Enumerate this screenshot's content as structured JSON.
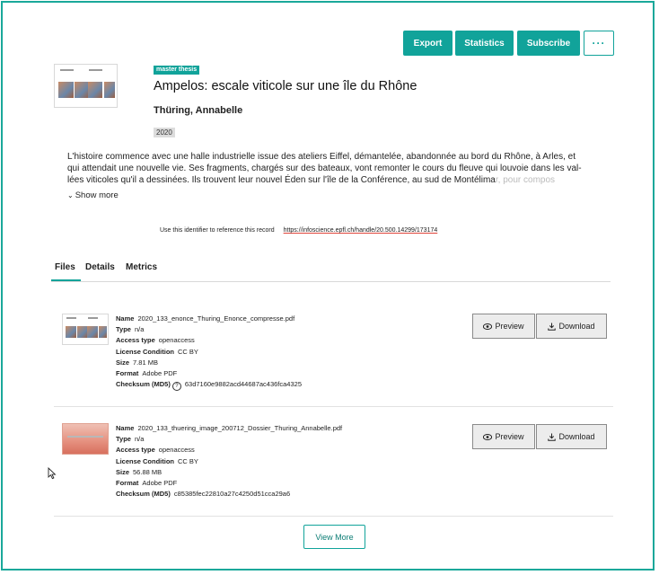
{
  "actions": {
    "export": "Export",
    "statistics": "Statistics",
    "subscribe": "Subscribe",
    "more": "···"
  },
  "record": {
    "type_badge": "master thesis",
    "title": "Ampelos: escale viticole sur une île du Rhône",
    "author": "Thüring, Annabelle",
    "year": "2020",
    "abstract_lines": [
      "L'histoire commence avec une halle industrielle issue des ateliers Eiffel, démantelée, abandonnée au bord du Rhône, à Arles, et",
      "qui attendait une nouvelle vie. Ses fragments, chargés sur des bateaux, vont remonter le cours du fleuve qui louvoie dans les val-",
      "lées viticoles qu'il a dessinées. Ils trouvent leur nouvel Éden sur l'île de la Conférence, au sud de Montélimar, pour compos"
    ],
    "show_more": "Show more",
    "identifier_label": "Use this identifier to reference this record",
    "identifier_url": "https://infoscience.epfl.ch/handle/20.500.14299/173174"
  },
  "tabs": [
    "Files",
    "Details",
    "Metrics"
  ],
  "field_labels": {
    "name": "Name",
    "type": "Type",
    "access": "Access type",
    "license": "License Condition",
    "size": "Size",
    "format": "Format",
    "checksum": "Checksum (MD5)"
  },
  "files": [
    {
      "name": "2020_133_enonce_Thuring_Enonce_compresse.pdf",
      "type": "n/a",
      "access": "openaccess",
      "license": "CC BY",
      "size": "7.81 MB",
      "format": "Adobe PDF",
      "checksum": "63d7160e9882acd44687ac436fca4325"
    },
    {
      "name": "2020_133_thuering_image_200712_Dossier_Thuring_Annabelle.pdf",
      "type": "n/a",
      "access": "openaccess",
      "license": "CC BY",
      "size": "56.88 MB",
      "format": "Adobe PDF",
      "checksum": "c85385fec22810a27c4250d51cca29a6"
    }
  ],
  "file_buttons": {
    "preview": "Preview",
    "download": "Download"
  },
  "view_more": "View More"
}
